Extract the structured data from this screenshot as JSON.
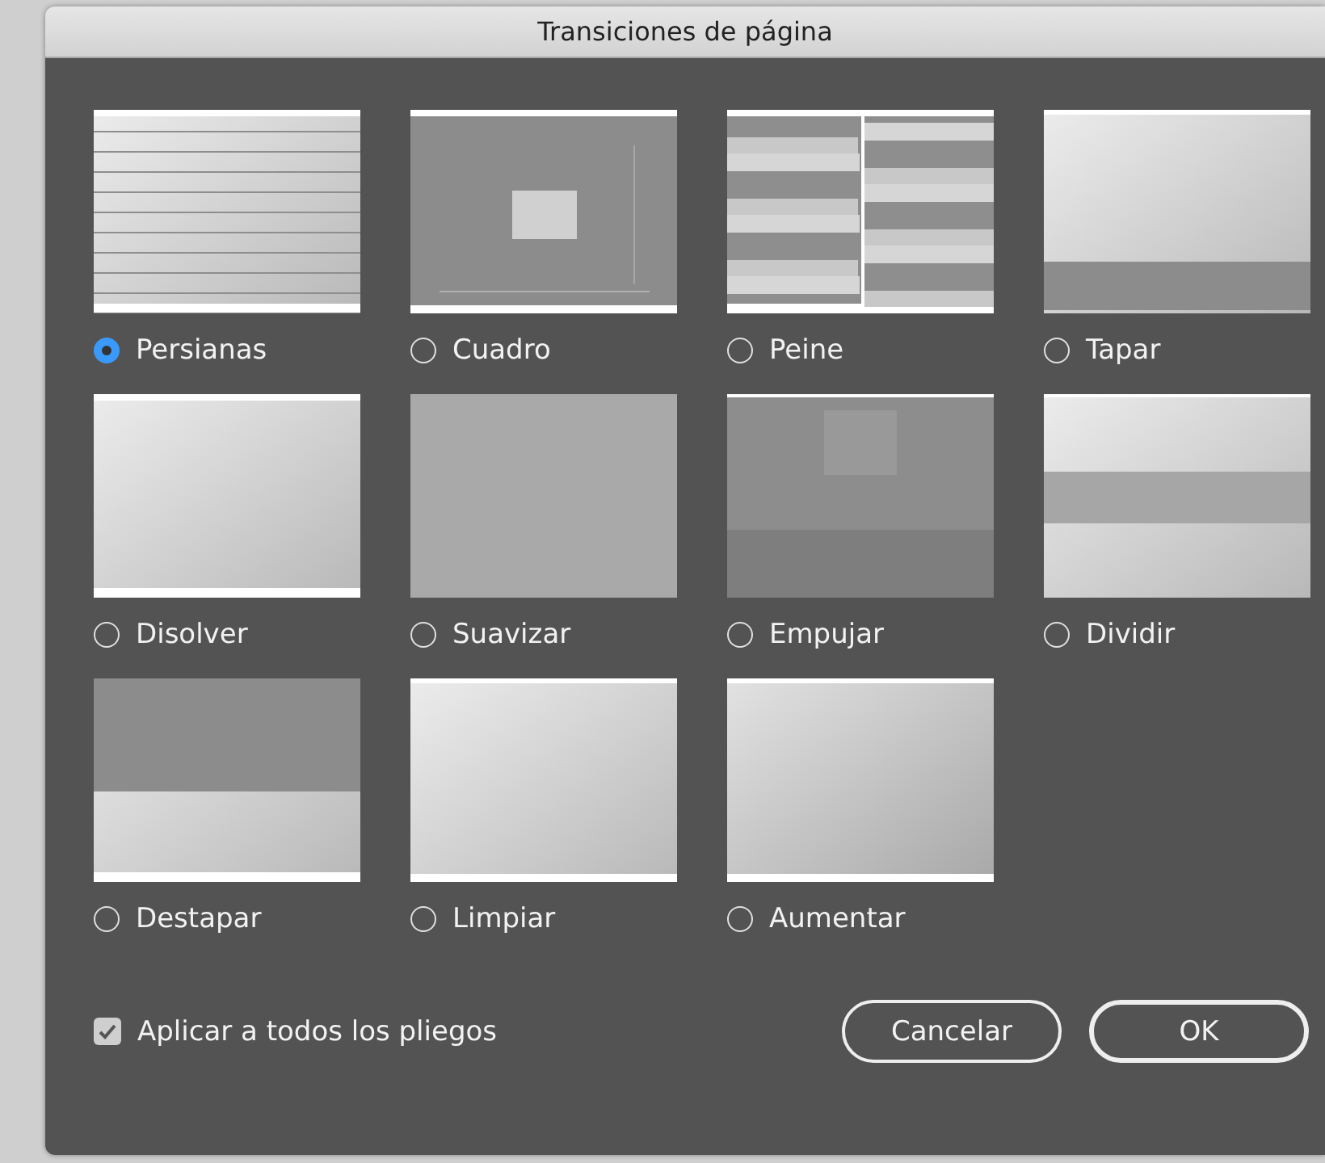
{
  "window": {
    "title": "Transiciones de página"
  },
  "options": [
    {
      "label": "Persianas",
      "kind": "blinds",
      "selected": true
    },
    {
      "label": "Cuadro",
      "kind": "box",
      "selected": false
    },
    {
      "label": "Peine",
      "kind": "comb",
      "selected": false
    },
    {
      "label": "Tapar",
      "kind": "cover",
      "selected": false
    },
    {
      "label": "Disolver",
      "kind": "dissolve",
      "selected": false
    },
    {
      "label": "Suavizar",
      "kind": "fade",
      "selected": false
    },
    {
      "label": "Empujar",
      "kind": "push",
      "selected": false
    },
    {
      "label": "Dividir",
      "kind": "split",
      "selected": false
    },
    {
      "label": "Destapar",
      "kind": "uncover",
      "selected": false
    },
    {
      "label": "Limpiar",
      "kind": "wipe",
      "selected": false
    },
    {
      "label": "Aumentar",
      "kind": "zoom",
      "selected": false
    }
  ],
  "apply_all": {
    "label": "Aplicar a todos los pliegos",
    "checked": true
  },
  "buttons": [
    {
      "label": "Cancelar",
      "kind": "cancel"
    },
    {
      "label": "OK",
      "kind": "ok"
    }
  ]
}
